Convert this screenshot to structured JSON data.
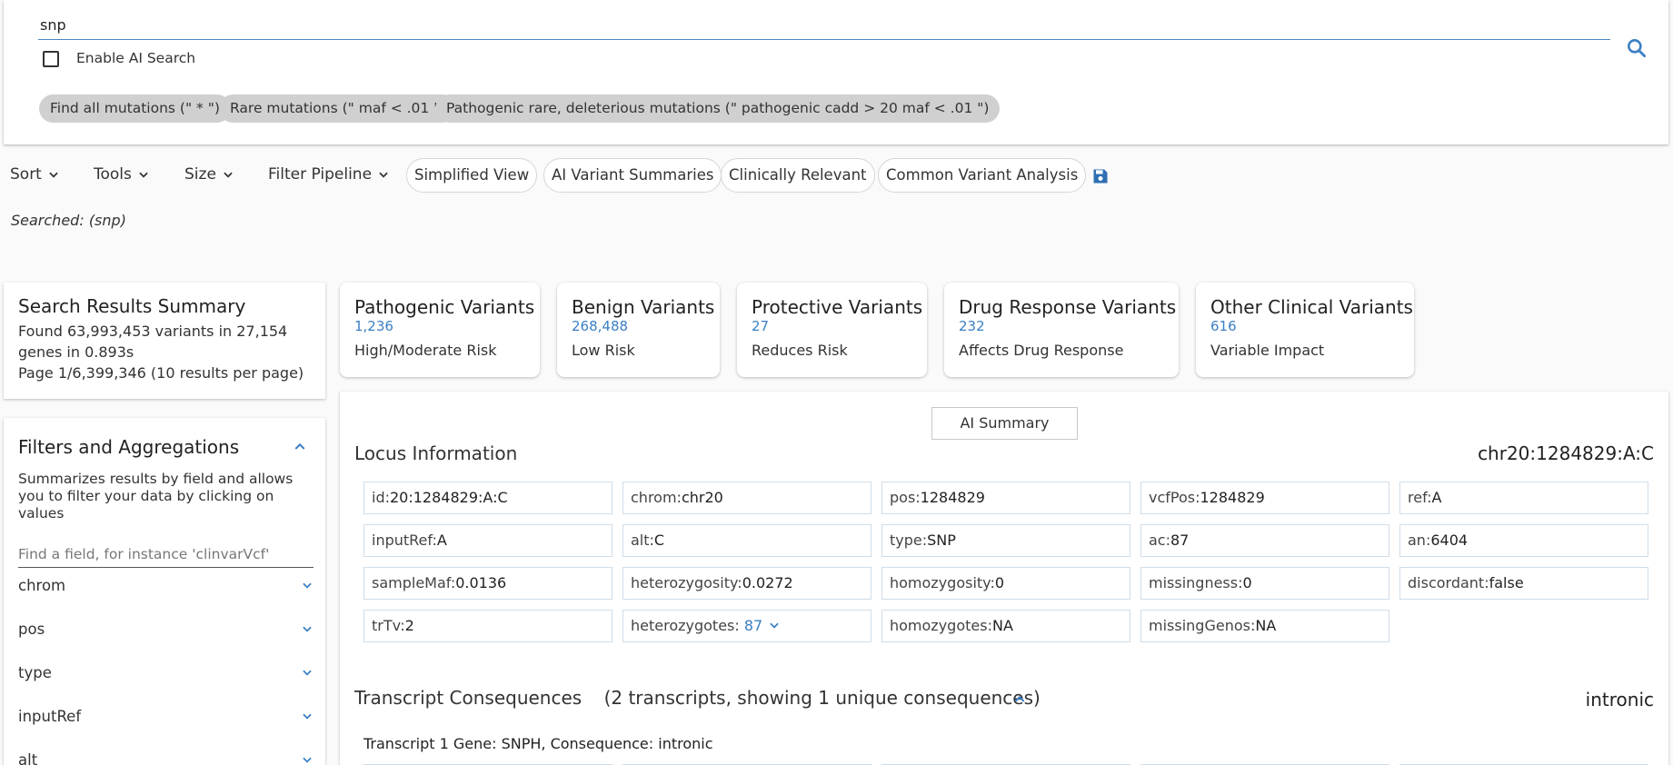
{
  "search": {
    "value": "snp",
    "ai_label": "Enable AI Search"
  },
  "chips": [
    "Find all mutations (\" * \")",
    "Rare mutations (\" maf < .01 \")",
    "Pathogenic rare, deleterious mutations (\" pathogenic cadd > 20 maf < .01 \")"
  ],
  "toolbar": {
    "sort": "Sort",
    "tools": "Tools",
    "size": "Size",
    "filter_pipeline": "Filter Pipeline",
    "simplified": "Simplified View",
    "ai_variant": "AI Variant Summaries",
    "clinically": "Clinically Relevant",
    "common": "Common Variant Analysis"
  },
  "searched": {
    "label": "Searched:",
    "term": "(snp)"
  },
  "summary": {
    "title": "Search Results Summary",
    "line1": "Found 63,993,453 variants in 27,154 genes in 0.893s",
    "line2": "Page 1/6,399,346 (10 results per page)"
  },
  "stats": [
    {
      "title": "Pathogenic Variants",
      "count": "1,236",
      "desc": "High/Moderate Risk"
    },
    {
      "title": "Benign Variants",
      "count": "268,488",
      "desc": "Low Risk"
    },
    {
      "title": "Protective Variants",
      "count": "27",
      "desc": "Reduces Risk"
    },
    {
      "title": "Drug Response Variants",
      "count": "232",
      "desc": "Affects Drug Response"
    },
    {
      "title": "Other Clinical Variants",
      "count": "616",
      "desc": "Variable Impact"
    }
  ],
  "filters": {
    "title": "Filters and Aggregations",
    "desc": "Summarizes results by field and allows you to filter your data by clicking on values",
    "placeholder": "Find a field, for instance 'clinvarVcf'",
    "fields": [
      "chrom",
      "pos",
      "type",
      "inputRef",
      "alt"
    ]
  },
  "detail": {
    "ai_summary": "AI Summary",
    "locus_title": "Locus Information",
    "locus_id": "chr20:1284829:A:C",
    "cells": [
      {
        "k": "id:",
        "v": "20:1284829:A:C"
      },
      {
        "k": "chrom:",
        "v": "chr20"
      },
      {
        "k": "pos:",
        "v": "1284829"
      },
      {
        "k": "vcfPos:",
        "v": "1284829"
      },
      {
        "k": "ref:",
        "v": "A"
      },
      {
        "k": "inputRef:",
        "v": "A"
      },
      {
        "k": "alt:",
        "v": "C"
      },
      {
        "k": "type:",
        "v": "SNP"
      },
      {
        "k": "ac:",
        "v": "87"
      },
      {
        "k": "an:",
        "v": "6404"
      },
      {
        "k": "sampleMaf:",
        "v": "0.0136"
      },
      {
        "k": "heterozygosity:",
        "v": "0.0272"
      },
      {
        "k": "homozygosity:",
        "v": "0"
      },
      {
        "k": "missingness:",
        "v": "0"
      },
      {
        "k": "discordant:",
        "v": "false"
      },
      {
        "k": "trTv:",
        "v": "2"
      },
      {
        "k": "heterozygotes: ",
        "v": "87"
      },
      {
        "k": "homozygotes:",
        "v": "NA"
      },
      {
        "k": "missingGenos:",
        "v": "NA"
      }
    ],
    "transcript_title": "Transcript Consequences",
    "transcript_sub": "(2 transcripts, showing 1 unique consequences)",
    "transcript_right": "intronic",
    "transcript_line": "Transcript 1 Gene: SNPH, Consequence: intronic"
  },
  "colors": {
    "accent": "#3b7fc4",
    "chip_bg": "#d0d0d0"
  }
}
